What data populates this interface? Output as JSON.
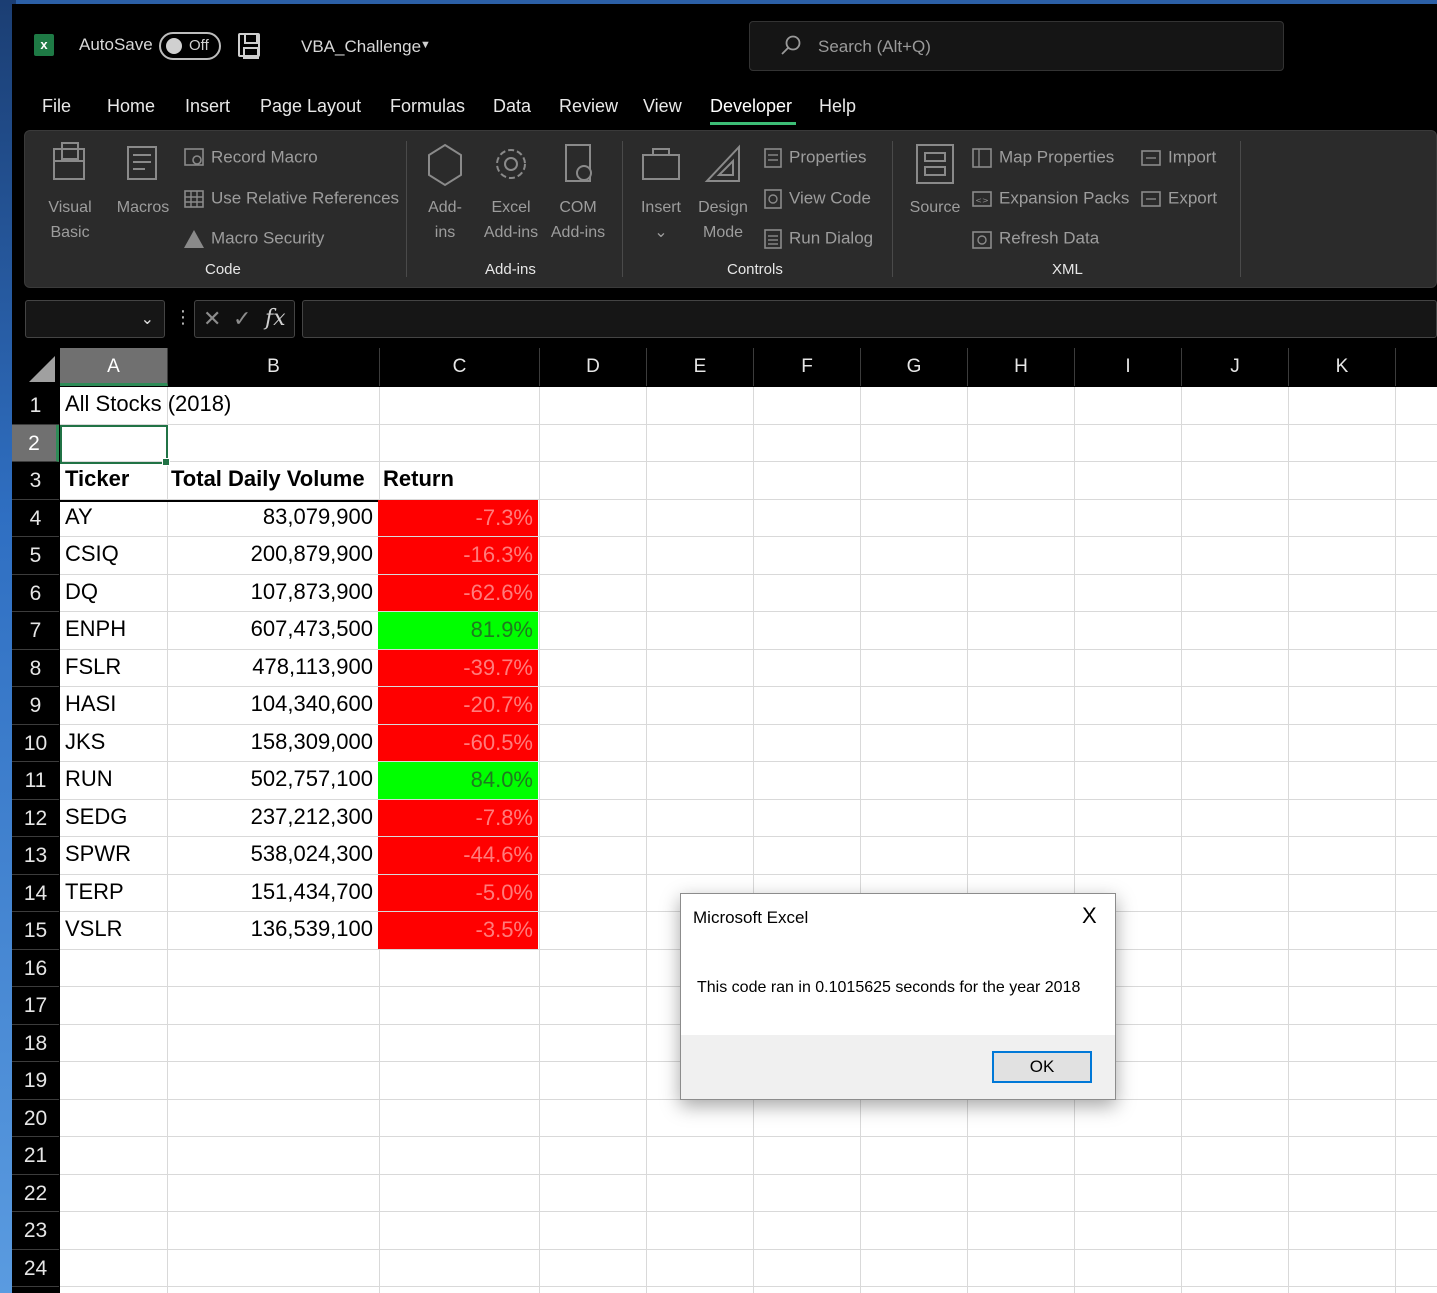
{
  "titlebar": {
    "app_icon_letter": "x",
    "autosave_label": "AutoSave",
    "autosave_state": "Off",
    "filename": "VBA_Challenge",
    "search_placeholder": "Search (Alt+Q)"
  },
  "tabs": [
    "File",
    "Home",
    "Insert",
    "Page Layout",
    "Formulas",
    "Data",
    "Review",
    "View",
    "Developer",
    "Help"
  ],
  "active_tab": "Developer",
  "ribbon": {
    "code": {
      "label": "Code",
      "visual_basic": [
        "Visual",
        "Basic"
      ],
      "macros": "Macros",
      "record_macro": "Record Macro",
      "use_relative": "Use Relative References",
      "macro_security": "Macro Security"
    },
    "addins": {
      "label": "Add-ins",
      "addins": [
        "Add-",
        "ins"
      ],
      "excel_addins": [
        "Excel",
        "Add-ins"
      ],
      "com_addins": [
        "COM",
        "Add-ins"
      ]
    },
    "controls": {
      "label": "Controls",
      "insert": "Insert",
      "insert_caret": "⌄",
      "design_mode": [
        "Design",
        "Mode"
      ],
      "properties": "Properties",
      "view_code": "View Code",
      "run_dialog": "Run Dialog"
    },
    "xml": {
      "label": "XML",
      "source": "Source",
      "map_properties": "Map Properties",
      "expansion_packs": "Expansion Packs",
      "refresh_data": "Refresh Data",
      "import": "Import",
      "export": "Export"
    }
  },
  "formula_bar": {
    "name_box": "",
    "formula": ""
  },
  "columns": [
    "A",
    "B",
    "C",
    "D",
    "E",
    "F",
    "G",
    "H",
    "I",
    "J",
    "K"
  ],
  "rows": [
    "1",
    "2",
    "3",
    "4",
    "5",
    "6",
    "7",
    "8",
    "9",
    "10",
    "11",
    "12",
    "13",
    "14",
    "15",
    "16",
    "17",
    "18",
    "19",
    "20",
    "21",
    "22",
    "23",
    "24"
  ],
  "sheet": {
    "title": "All Stocks (2018)",
    "headers": {
      "ticker": "Ticker",
      "volume": "Total Daily Volume",
      "return": "Return"
    },
    "data": [
      {
        "ticker": "AY",
        "volume": "83,079,900",
        "ret": "-7.3%",
        "sign": "neg"
      },
      {
        "ticker": "CSIQ",
        "volume": "200,879,900",
        "ret": "-16.3%",
        "sign": "neg"
      },
      {
        "ticker": "DQ",
        "volume": "107,873,900",
        "ret": "-62.6%",
        "sign": "neg"
      },
      {
        "ticker": "ENPH",
        "volume": "607,473,500",
        "ret": "81.9%",
        "sign": "pos"
      },
      {
        "ticker": "FSLR",
        "volume": "478,113,900",
        "ret": "-39.7%",
        "sign": "neg"
      },
      {
        "ticker": "HASI",
        "volume": "104,340,600",
        "ret": "-20.7%",
        "sign": "neg"
      },
      {
        "ticker": "JKS",
        "volume": "158,309,000",
        "ret": "-60.5%",
        "sign": "neg"
      },
      {
        "ticker": "RUN",
        "volume": "502,757,100",
        "ret": "84.0%",
        "sign": "pos"
      },
      {
        "ticker": "SEDG",
        "volume": "237,212,300",
        "ret": "-7.8%",
        "sign": "neg"
      },
      {
        "ticker": "SPWR",
        "volume": "538,024,300",
        "ret": "-44.6%",
        "sign": "neg"
      },
      {
        "ticker": "TERP",
        "volume": "151,434,700",
        "ret": "-5.0%",
        "sign": "neg"
      },
      {
        "ticker": "VSLR",
        "volume": "136,539,100",
        "ret": "-3.5%",
        "sign": "neg"
      }
    ]
  },
  "dialog": {
    "title": "Microsoft Excel",
    "close": "X",
    "message": "This code ran in 0.1015625 seconds for the year 2018",
    "ok_label": "OK"
  },
  "colors": {
    "negative_fill": "#ff0000",
    "positive_fill": "#00ff00",
    "selection_accent": "#217346"
  }
}
